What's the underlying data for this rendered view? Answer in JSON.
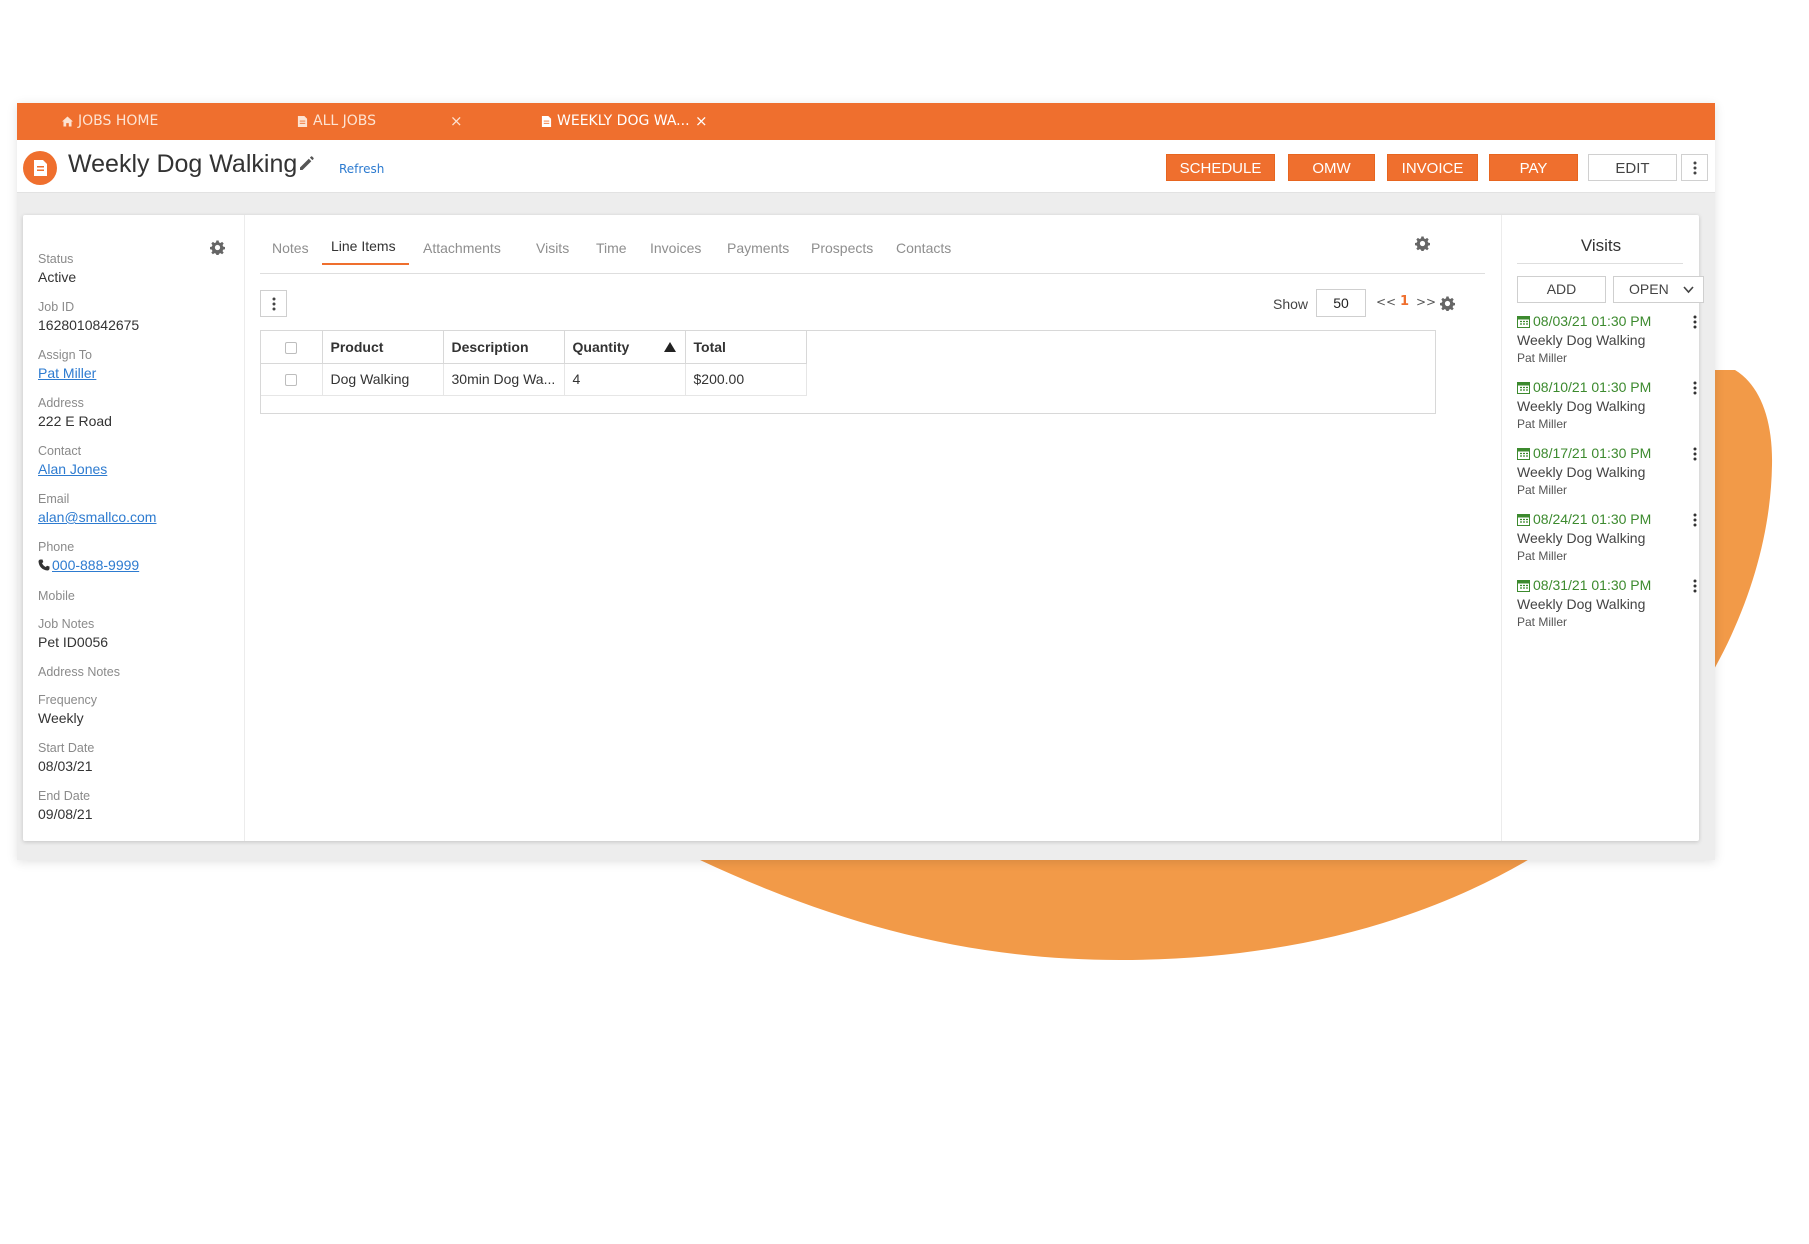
{
  "colors": {
    "accent": "#ef6f2e",
    "link": "#2d7bd0",
    "visit_date": "#3c8a2e",
    "blob": "#f29a48"
  },
  "tabs": [
    {
      "label": "JOBS HOME",
      "icon": "home-icon"
    },
    {
      "label": "ALL JOBS",
      "icon": "file-icon",
      "close": "×"
    },
    {
      "label": "WEEKLY DOG WA...",
      "icon": "file-icon",
      "close": "×",
      "active": true
    }
  ],
  "header": {
    "title": "Weekly Dog Walking",
    "refresh_label": "Refresh",
    "actions": [
      "SCHEDULE",
      "OMW",
      "INVOICE",
      "PAY",
      "EDIT"
    ]
  },
  "info": {
    "status_label": "Status",
    "status": "Active",
    "job_id_label": "Job ID",
    "job_id": "1628010842675",
    "assign_label": "Assign To",
    "assign": "Pat Miller",
    "address_label": "Address",
    "address": "222 E Road",
    "contact_label": "Contact",
    "contact": "Alan Jones",
    "email_label": "Email",
    "email": "alan@smallco.com",
    "phone_label": "Phone",
    "phone": "000-888-9999",
    "mobile_label": "Mobile",
    "job_notes_label": "Job Notes",
    "job_notes": "Pet ID0056",
    "address_notes_label": "Address Notes",
    "frequency_label": "Frequency",
    "frequency": "Weekly",
    "start_label": "Start Date",
    "start": "08/03/21",
    "end_label": "End Date",
    "end": "09/08/21"
  },
  "subtabs": [
    "Notes",
    "Line Items",
    "Attachments",
    "Visits",
    "Time",
    "Invoices",
    "Payments",
    "Prospects",
    "Contacts"
  ],
  "grid": {
    "show_label": "Show",
    "page_size": "50",
    "pager_prev": "<<",
    "page": "1",
    "pager_next": ">>",
    "columns": [
      "Product",
      "Description",
      "Quantity",
      "Total"
    ],
    "rows": [
      {
        "product": "Dog Walking",
        "description": "30min Dog Wa...",
        "quantity": "4",
        "total": "$200.00"
      }
    ]
  },
  "visits": {
    "title": "Visits",
    "add_label": "ADD",
    "filter_label": "OPEN",
    "items": [
      {
        "date": "08/03/21 01:30 PM",
        "name": "Weekly Dog Walking",
        "person": "Pat Miller"
      },
      {
        "date": "08/10/21 01:30 PM",
        "name": "Weekly Dog Walking",
        "person": "Pat Miller"
      },
      {
        "date": "08/17/21 01:30 PM",
        "name": "Weekly Dog Walking",
        "person": "Pat Miller"
      },
      {
        "date": "08/24/21 01:30 PM",
        "name": "Weekly Dog Walking",
        "person": "Pat Miller"
      },
      {
        "date": "08/31/21 01:30 PM",
        "name": "Weekly Dog Walking",
        "person": "Pat Miller"
      }
    ]
  }
}
